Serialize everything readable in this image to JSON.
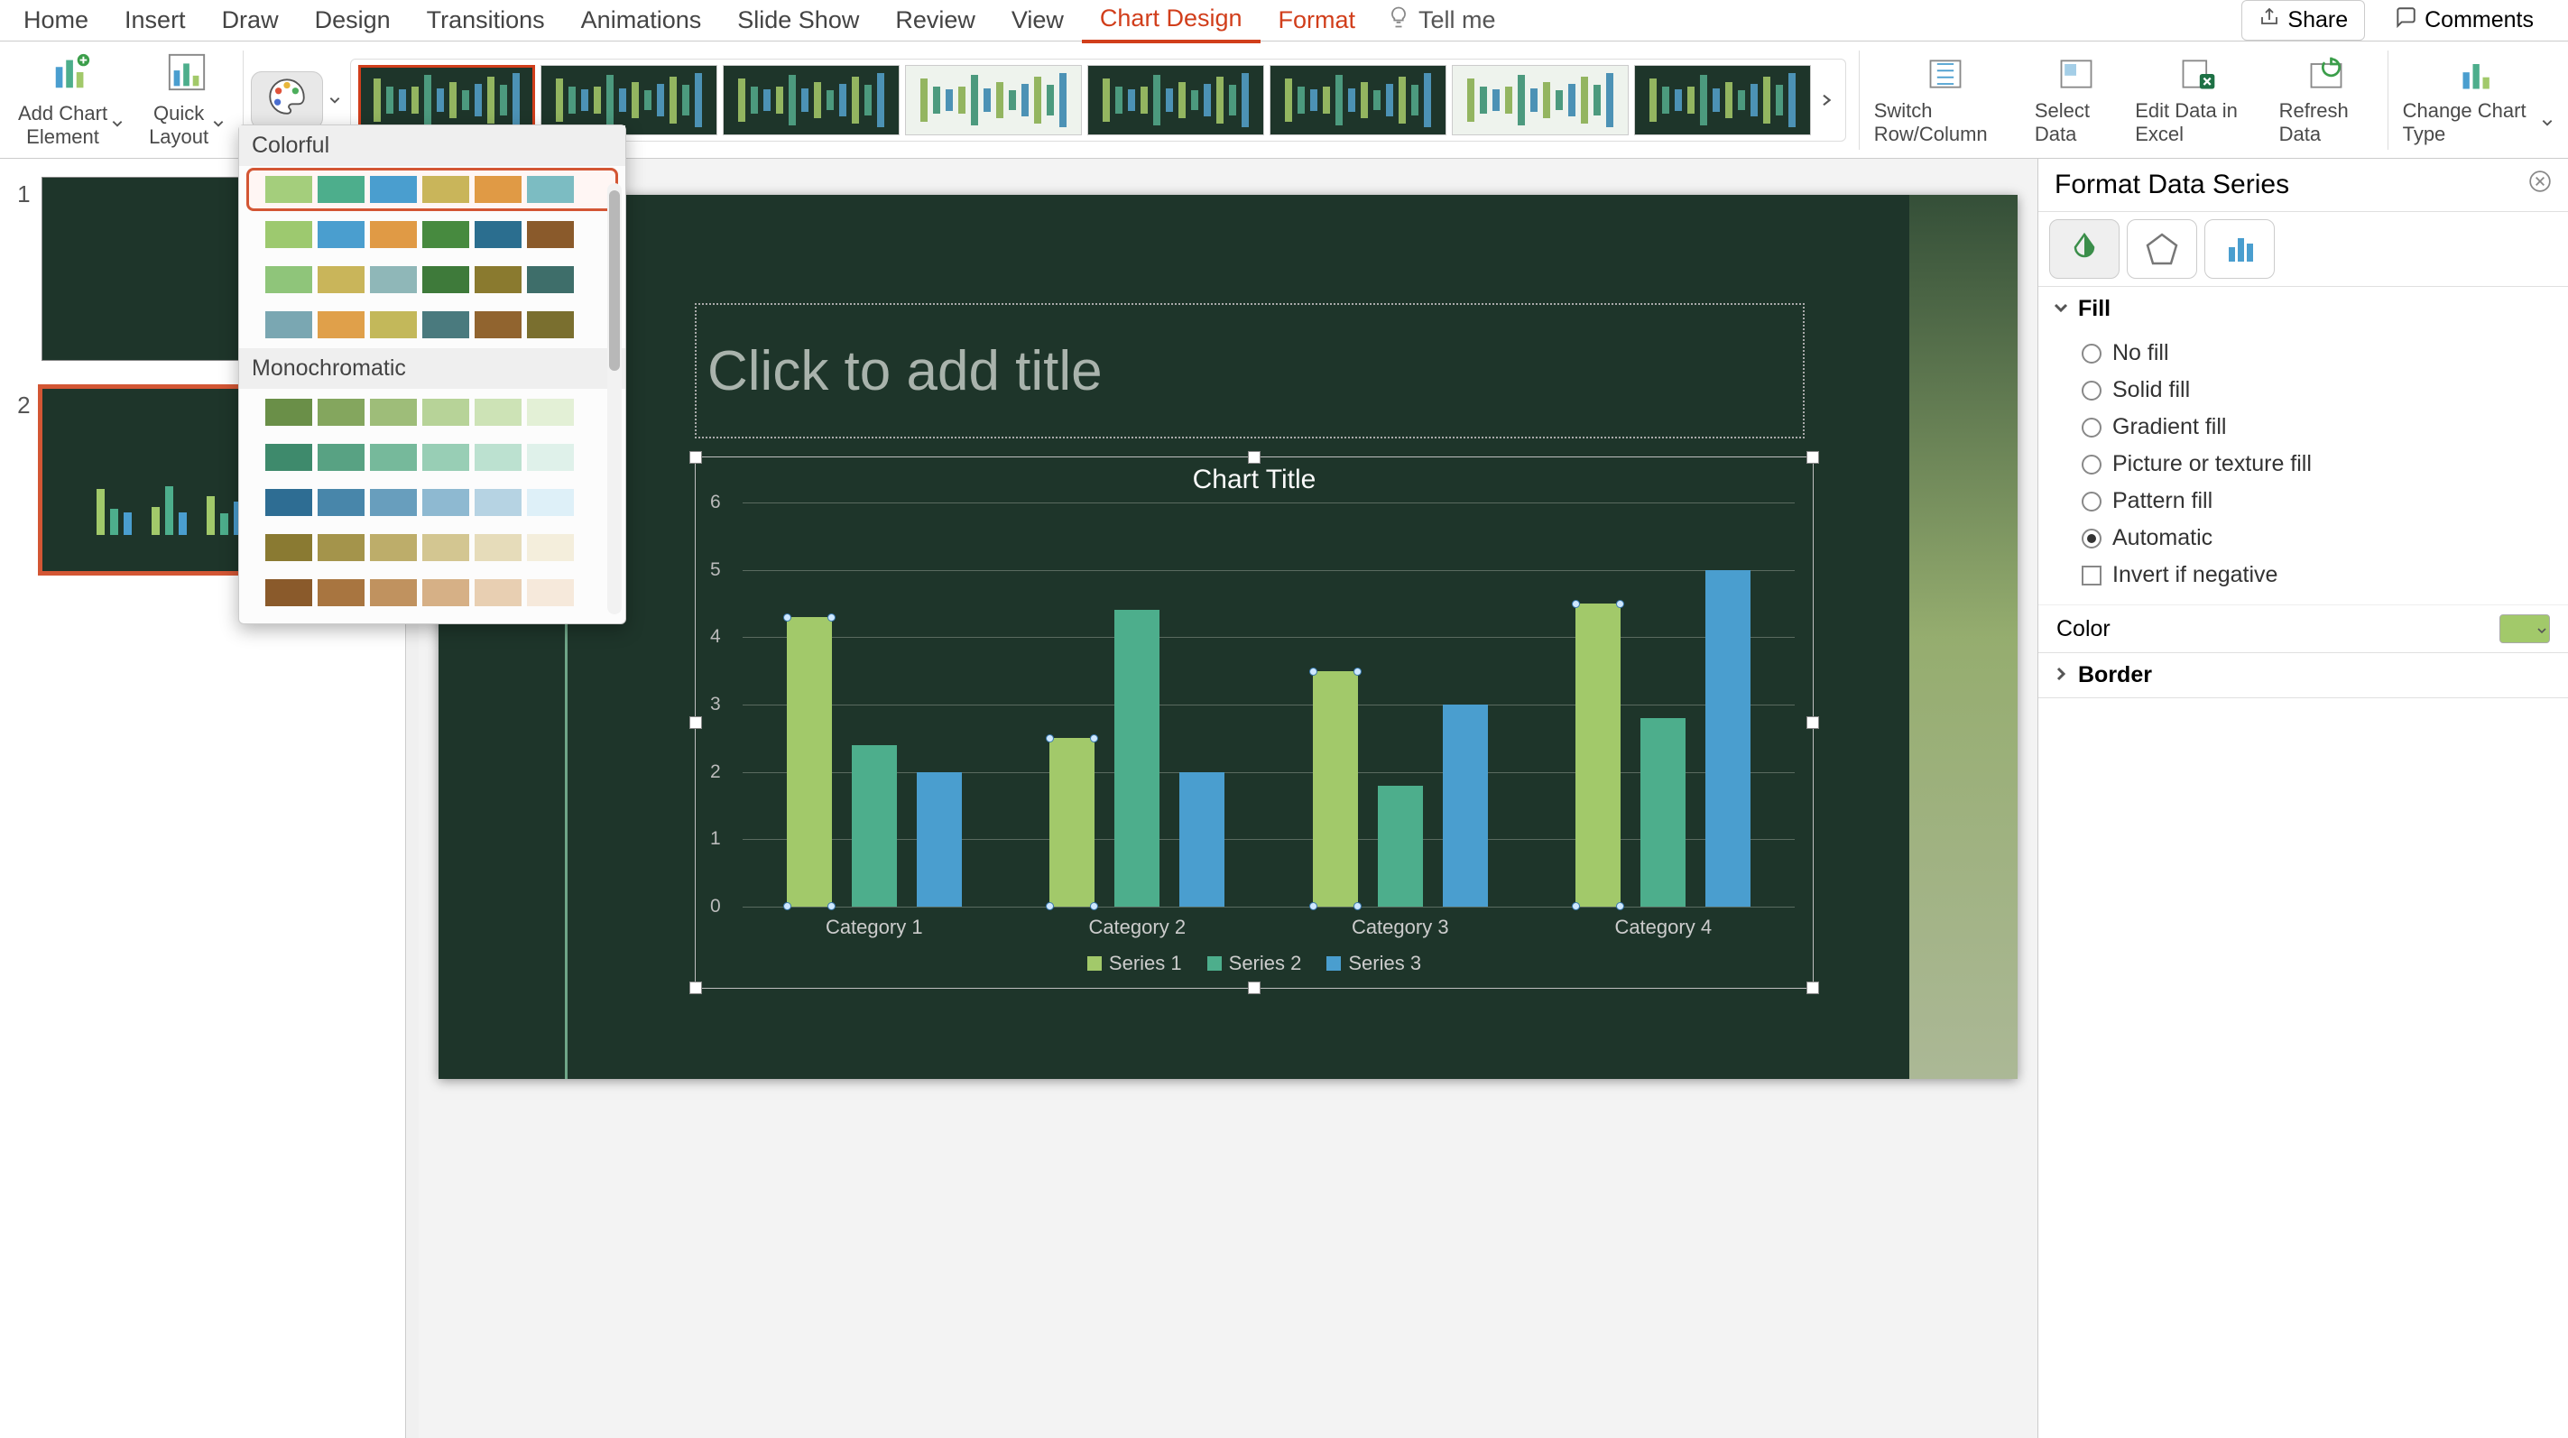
{
  "menu": {
    "items": [
      "Home",
      "Insert",
      "Draw",
      "Design",
      "Transitions",
      "Animations",
      "Slide Show",
      "Review",
      "View",
      "Chart Design",
      "Format"
    ],
    "active": "Chart Design",
    "tell_me": "Tell me",
    "share": "Share",
    "comments": "Comments"
  },
  "ribbon": {
    "add_chart_element": "Add Chart\nElement",
    "quick_layout": "Quick\nLayout",
    "switch_row_col": "Switch\nRow/Column",
    "select_data": "Select\nData",
    "edit_data_excel": "Edit Data\nin Excel",
    "refresh_data": "Refresh\nData",
    "change_chart_type": "Change\nChart Type"
  },
  "color_popup": {
    "section_colorful": "Colorful",
    "section_monochrome": "Monochromatic",
    "colorful_rows": [
      [
        "#a4ce7c",
        "#4dae8c",
        "#4a9ecf",
        "#c9b55a",
        "#e09a45",
        "#7cbcc2"
      ],
      [
        "#9dc96f",
        "#4a9ecf",
        "#e09a45",
        "#478a3f",
        "#2b6e8f",
        "#8a5a2b"
      ],
      [
        "#8fc57a",
        "#c9b55a",
        "#8fb7b8",
        "#3e7a3a",
        "#8a7a2f",
        "#3e6e6a"
      ],
      [
        "#7aa7b2",
        "#e0a04a",
        "#c3b85a",
        "#4a7a7e",
        "#91642f",
        "#7a6f2f"
      ]
    ],
    "mono_rows": [
      [
        "#6a8f48",
        "#84a65e",
        "#9ebd79",
        "#b7d398",
        "#cde3b6",
        "#e3f0d6"
      ],
      [
        "#3e8a6c",
        "#58a283",
        "#76b99b",
        "#98ceb5",
        "#bce1d0",
        "#dff1ea"
      ],
      [
        "#2e6d93",
        "#4886aa",
        "#689ebd",
        "#8eb9d1",
        "#b6d3e3",
        "#def0f8"
      ],
      [
        "#8a7a32",
        "#a4944b",
        "#bdad6a",
        "#d3c691",
        "#e6dcba",
        "#f4eedc"
      ],
      [
        "#8a5a2b",
        "#a87540",
        "#c0925f",
        "#d6b086",
        "#e8cfb2",
        "#f6e9db"
      ]
    ],
    "selected_row_index": 0
  },
  "slides": {
    "items": [
      {
        "num": "1"
      },
      {
        "num": "2"
      }
    ],
    "selected_index": 1
  },
  "canvas": {
    "title_placeholder": "Click to add title"
  },
  "chart_data": {
    "type": "bar",
    "title": "Chart Title",
    "categories": [
      "Category 1",
      "Category 2",
      "Category 3",
      "Category 4"
    ],
    "series": [
      {
        "name": "Series 1",
        "color": "#a2c96a",
        "values": [
          4.3,
          2.5,
          3.5,
          4.5
        ],
        "selected": true
      },
      {
        "name": "Series 2",
        "color": "#4dae8c",
        "values": [
          2.4,
          4.4,
          1.8,
          2.8
        ]
      },
      {
        "name": "Series 3",
        "color": "#4a9ecf",
        "values": [
          2.0,
          2.0,
          3.0,
          5.0
        ]
      }
    ],
    "ylim": [
      0,
      6
    ],
    "yticks": [
      0,
      1,
      2,
      3,
      4,
      5,
      6
    ],
    "xlabel": "",
    "ylabel": ""
  },
  "right_pane": {
    "title": "Format Data Series",
    "tabs": [
      "fill-line",
      "effects",
      "series-options"
    ],
    "sections": {
      "fill": {
        "label": "Fill",
        "options": {
          "no_fill": "No fill",
          "solid_fill": "Solid fill",
          "gradient_fill": "Gradient fill",
          "picture_fill": "Picture or texture fill",
          "pattern_fill": "Pattern fill",
          "automatic": "Automatic",
          "invert_negative": "Invert if negative"
        },
        "selected": "automatic",
        "color_label": "Color",
        "color_value": "#a2c96a"
      },
      "border": {
        "label": "Border"
      }
    }
  }
}
